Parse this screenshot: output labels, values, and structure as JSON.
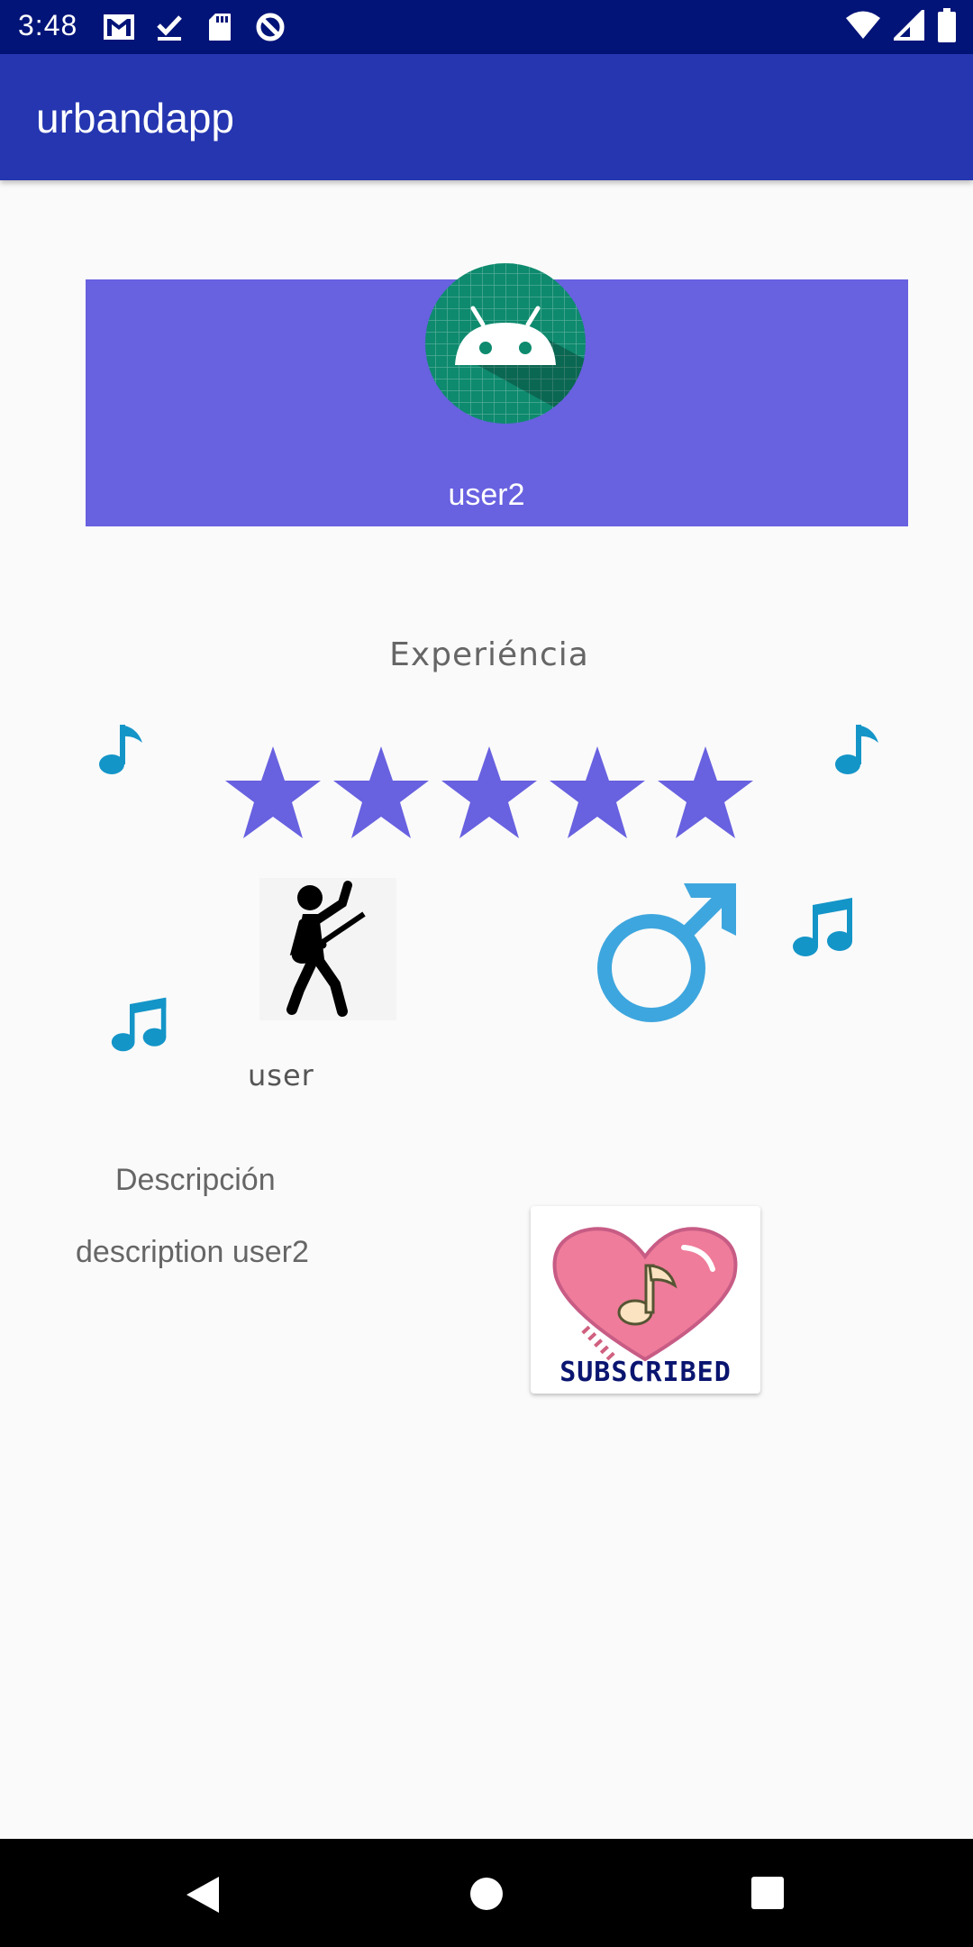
{
  "status_bar": {
    "time": "3:48",
    "left_icons": [
      "gmail-icon",
      "download-done-icon",
      "sd-card-icon",
      "data-saver-icon"
    ],
    "right_icons": [
      "wifi-icon",
      "cell-signal-icon",
      "battery-icon"
    ]
  },
  "app_bar": {
    "title": "urbandapp"
  },
  "profile": {
    "username": "user2",
    "avatar_icon": "android-avatar-icon"
  },
  "experience": {
    "label": "Experiéncia",
    "rating": 5,
    "max_rating": 5
  },
  "musician": {
    "role": "user",
    "icon": "guitar-player-icon",
    "gender_icon": "male-symbol-icon"
  },
  "description": {
    "title": "Descripción",
    "text": "description user2"
  },
  "subscribe": {
    "label": "SUBSCRIBED",
    "icon": "heart-music-note-icon"
  },
  "nav_bar": {
    "buttons": [
      "back-icon",
      "home-icon",
      "recents-icon"
    ]
  },
  "colors": {
    "status_bar": "#031478",
    "app_bar": "#2536b0",
    "profile_card": "#6861e0",
    "star": "#6861e0",
    "note": "#1495c8"
  }
}
